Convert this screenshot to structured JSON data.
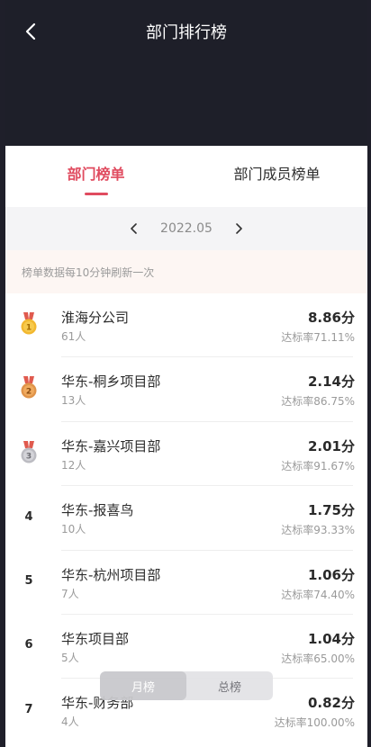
{
  "header": {
    "title": "部门排行榜"
  },
  "tabs": [
    {
      "label": "部门榜单",
      "active": true
    },
    {
      "label": "部门成员榜单",
      "active": false
    }
  ],
  "month_selector": {
    "value": "2022.05"
  },
  "notice": "榜单数据每10分钟刷新一次",
  "ranking": [
    {
      "rank": "1",
      "medal": "gold-medal",
      "name": "淮海分公司",
      "count": "61人",
      "score": "8.86分",
      "rate": "达标率71.11%"
    },
    {
      "rank": "2",
      "medal": "silver-medal",
      "name": "华东-桐乡项目部",
      "count": "13人",
      "score": "2.14分",
      "rate": "达标率86.75%"
    },
    {
      "rank": "3",
      "medal": "bronze-medal",
      "name": "华东-嘉兴项目部",
      "count": "12人",
      "score": "2.01分",
      "rate": "达标率91.67%"
    },
    {
      "rank": "4",
      "name": "华东-报喜鸟",
      "count": "10人",
      "score": "1.75分",
      "rate": "达标率93.33%"
    },
    {
      "rank": "5",
      "name": "华东-杭州项目部",
      "count": "7人",
      "score": "1.06分",
      "rate": "达标率74.40%"
    },
    {
      "rank": "6",
      "name": "华东项目部",
      "count": "5人",
      "score": "1.04分",
      "rate": "达标率65.00%"
    },
    {
      "rank": "7",
      "name": "华东-财务部",
      "count": "4人",
      "score": "0.82分",
      "rate": "达标率100.00%"
    }
  ],
  "toggle": {
    "monthly": "月榜",
    "total": "总榜",
    "selected": "月榜"
  },
  "colors": {
    "accent": "#e04b5f",
    "header_bg": "#1e1f29",
    "notice_bg": "#fdf6f3"
  }
}
